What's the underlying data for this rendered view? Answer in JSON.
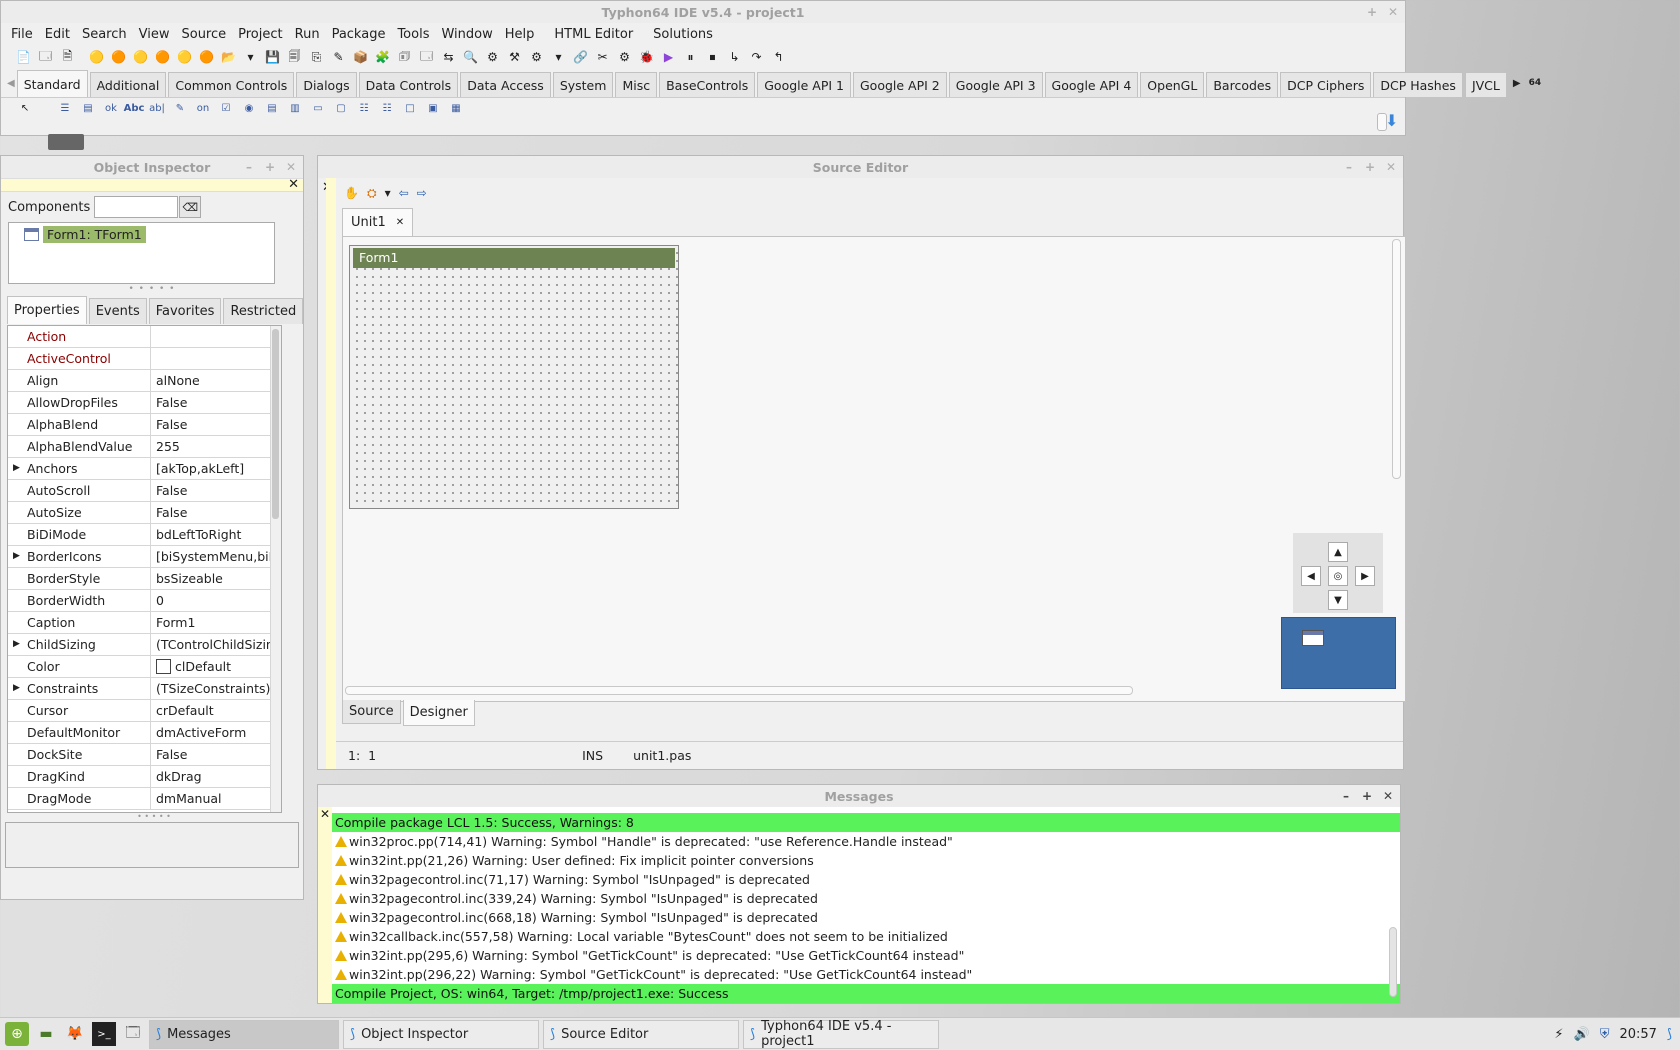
{
  "main": {
    "title": "Typhon64 IDE v5.4 - project1",
    "menu": [
      "File",
      "Edit",
      "Search",
      "View",
      "Source",
      "Project",
      "Run",
      "Package",
      "Tools",
      "Window",
      "Help",
      "HTML Editor",
      "Solutions"
    ],
    "palette_tabs": [
      "Standard",
      "Additional",
      "Common Controls",
      "Dialogs",
      "Data Controls",
      "Data Access",
      "System",
      "Misc",
      "BaseControls",
      "Google API 1",
      "Google API 2",
      "Google API 3",
      "Google API 4",
      "OpenGL",
      "Barcodes",
      "DCP Ciphers",
      "DCP Hashes",
      "JVCL"
    ],
    "active_tab": "Standard",
    "bit_label": "64",
    "comp_labels": {
      "button": "ok",
      "label": "Abc",
      "edit": "ab|",
      "toggle": "on"
    }
  },
  "inspector": {
    "title": "Object Inspector",
    "components_label": "Components",
    "tree_item": "Form1: TForm1",
    "tabs": [
      "Properties",
      "Events",
      "Favorites",
      "Restricted"
    ],
    "properties": [
      {
        "name": "Action",
        "value": "",
        "red": true
      },
      {
        "name": "ActiveControl",
        "value": "",
        "red": true
      },
      {
        "name": "Align",
        "value": "alNone"
      },
      {
        "name": "AllowDropFiles",
        "value": "False"
      },
      {
        "name": "AlphaBlend",
        "value": "False"
      },
      {
        "name": "AlphaBlendValue",
        "value": "255"
      },
      {
        "name": "Anchors",
        "value": "[akTop,akLeft]",
        "expand": true
      },
      {
        "name": "AutoScroll",
        "value": "False"
      },
      {
        "name": "AutoSize",
        "value": "False"
      },
      {
        "name": "BiDiMode",
        "value": "bdLeftToRight"
      },
      {
        "name": "BorderIcons",
        "value": "[biSystemMenu,biMinim",
        "expand": true
      },
      {
        "name": "BorderStyle",
        "value": "bsSizeable"
      },
      {
        "name": "BorderWidth",
        "value": "0"
      },
      {
        "name": "Caption",
        "value": "Form1"
      },
      {
        "name": "ChildSizing",
        "value": "(TControlChildSizing)",
        "expand": true
      },
      {
        "name": "Color",
        "value": "clDefault",
        "swatch": true
      },
      {
        "name": "Constraints",
        "value": "(TSizeConstraints)",
        "expand": true
      },
      {
        "name": "Cursor",
        "value": "crDefault"
      },
      {
        "name": "DefaultMonitor",
        "value": "dmActiveForm"
      },
      {
        "name": "DockSite",
        "value": "False"
      },
      {
        "name": "DragKind",
        "value": "dkDrag"
      },
      {
        "name": "DragMode",
        "value": "dmManual"
      }
    ]
  },
  "editor": {
    "title": "Source Editor",
    "tab": "Unit1",
    "form_caption": "Form1",
    "bottom_tabs": [
      "Source",
      "Designer"
    ],
    "active_bottom_tab": "Designer",
    "status": {
      "pos_line": "1:",
      "pos_col": "1",
      "mode": "INS",
      "file": "unit1.pas"
    }
  },
  "messages": {
    "title": "Messages",
    "lines": [
      {
        "text": "Compile package LCL 1.5: Success, Warnings: 8",
        "type": "success"
      },
      {
        "text": "win32proc.pp(714,41) Warning: Symbol \"Handle\" is deprecated: \"use Reference.Handle instead\"",
        "type": "warning"
      },
      {
        "text": "win32int.pp(21,26) Warning: User defined: Fix implicit pointer conversions",
        "type": "warning"
      },
      {
        "text": "win32pagecontrol.inc(71,17) Warning: Symbol \"IsUnpaged\" is deprecated",
        "type": "warning"
      },
      {
        "text": "win32pagecontrol.inc(339,24) Warning: Symbol \"IsUnpaged\" is deprecated",
        "type": "warning"
      },
      {
        "text": "win32pagecontrol.inc(668,18) Warning: Symbol \"IsUnpaged\" is deprecated",
        "type": "warning"
      },
      {
        "text": "win32callback.inc(557,58) Warning: Local variable \"BytesCount\" does not seem to be initialized",
        "type": "warning"
      },
      {
        "text": "win32int.pp(295,6) Warning: Symbol \"GetTickCount\" is deprecated: \"Use GetTickCount64 instead\"",
        "type": "warning"
      },
      {
        "text": "win32int.pp(296,22) Warning: Symbol \"GetTickCount\" is deprecated: \"Use GetTickCount64 instead\"",
        "type": "warning"
      },
      {
        "text": "Compile Project, OS: win64, Target: /tmp/project1.exe: Success",
        "type": "success"
      }
    ]
  },
  "taskbar": {
    "tasks": [
      {
        "label": "Messages",
        "active": true
      },
      {
        "label": "Object Inspector",
        "active": false
      },
      {
        "label": "Source Editor",
        "active": false
      },
      {
        "label": "Typhon64 IDE v5.4 - project1",
        "active": false
      }
    ],
    "clock": "20:57"
  },
  "colors": {
    "success": "#5af25a",
    "form_title": "#6e8352",
    "minimap": "#3e6ea8",
    "warning": "#e8b000"
  }
}
